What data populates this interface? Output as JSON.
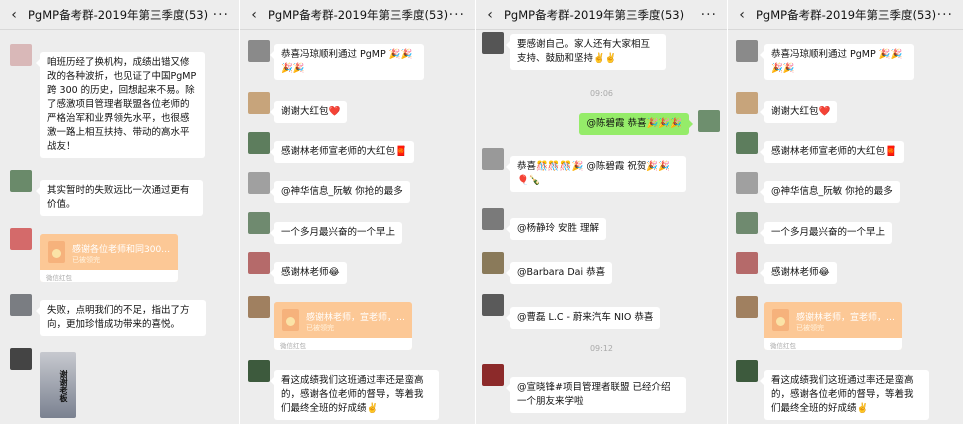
{
  "title": "PgMP备考群-2019年第三季度(53)",
  "panel1": {
    "m1": "咱班历经了换机构，成绩出错又修改的各种波折，也见证了中国PgMP 跨 300 的历史，回想起来不易。除了感激项目管理者联盟各位老师的严格治军和业界领先水平，也很感激一路上相互扶持、带动的高水平战友！",
    "m2": "其实暂时的失败远比一次通过更有价值。",
    "rp_text": "感谢各位老师和同300…",
    "rp_sub": "已被领完",
    "rp_foot": "微信红包",
    "m3": "失败，点明我们的不足，指出了方向，更加珍惜成功带来的喜悦。",
    "avatar_text": "谢谢老板"
  },
  "panel2": {
    "m1": "恭喜冯琼顺利通过 PgMP 🎉🎉🎉🎉",
    "m2": "谢谢大红包❤️",
    "m3": "感谢林老师宣老师的大红包🧧",
    "m4": "@神华信息_阮敏  你抢的最多",
    "m5": "一个多月最兴奋的一个早上",
    "m6": "感谢林老师😂",
    "rp_text": "感谢林老师，宣老师，…",
    "rp_sub": "已被领完",
    "rp_foot": "微信红包",
    "m7": "看这成绩我们这班通过率还是蛮高的，感谢各位老师的督导，等着我们最终全班的好成绩✌️"
  },
  "panel3": {
    "m1": "要感谢自己。家人还有大家相互支持、鼓励和坚持✌️✌️",
    "time1": "09:06",
    "m2": "@陈碧霞  恭喜🎉🎉🎉",
    "m3": "恭喜🎊🎊🎊🎉 @陈碧霞 祝贺🎉🎉🎈🍾",
    "m4": "@杨静玲 安胜  理解",
    "m5": "@Barbara Dai  恭喜",
    "m6": "@曹磊 L.C - 蔚来汽车 NIO  恭喜",
    "time2": "09:12",
    "m7": "@宣晓锋#项目管理者联盟  已经介绍一个朋友来学啦"
  },
  "panel4": {
    "m1": "恭喜冯琼顺利通过 PgMP 🎉🎉🎉🎉",
    "m2": "谢谢大红包❤️",
    "m3": "感谢林老师宣老师的大红包🧧",
    "m4": "@神华信息_阮敏  你抢的最多",
    "m5": "一个多月最兴奋的一个早上",
    "m6": "感谢林老师😂",
    "rp_text": "感谢林老师，宣老师，…",
    "rp_sub": "已被领完",
    "rp_foot": "微信红包",
    "m7": "看这成绩我们这班通过率还是蛮高的，感谢各位老师的督导，等着我们最终全班的好成绩✌️"
  },
  "icons": {
    "back": "chevron-left-icon",
    "more": "more-dots-icon",
    "redpacket": "red-packet-icon"
  },
  "colors": {
    "chat_bg": "#ededed",
    "bubble": "#ffffff",
    "self_bubble": "#95ec69",
    "red_packet": "#fcc896"
  }
}
